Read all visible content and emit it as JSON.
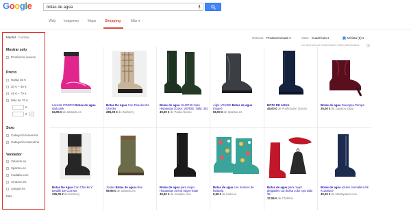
{
  "header": {
    "logo": [
      "G",
      "o",
      "o",
      "g",
      "l",
      "e"
    ],
    "logo_colors": [
      "#4285f4",
      "#ea4335",
      "#fbbc05",
      "#4285f4",
      "#34a853",
      "#ea4335"
    ],
    "search_value": "botas de agua"
  },
  "tabs": [
    "Web",
    "Imágenes",
    "Maps",
    "Shopping",
    "Más ▾"
  ],
  "active_tab": "Shopping",
  "sidebar": {
    "location": "Madrid",
    "location_change": "Cambiar",
    "show_only_head": "Mostrar solo",
    "show_only_items": [
      "Productos nuevos"
    ],
    "price_head": "Precio",
    "price_items": [
      "Hasta 30 €",
      "30 € – 45 €",
      "45 € – 70 €",
      "Más de 70 €"
    ],
    "price_currency": "€",
    "price_go": "›",
    "sex_head": "Sexo",
    "sex_items": [
      "Categoría femenina",
      "Categoría masculina"
    ],
    "seller_head": "Vendedor",
    "seller_items": [
      "Zalando.es",
      "Spartoo.es",
      "modalia.com",
      "Amazon.es",
      "camper.es"
    ],
    "more": "Más"
  },
  "controls": {
    "sort_label": "Ordenar:",
    "sort_value": "Predeterminada ▾",
    "view_label": "Vista:",
    "view_value": "Cuadrícula ▾",
    "mylist": "Mi lista (0) ▾",
    "note": "Los anuncios de comerciantes están patrocinados"
  },
  "products": [
    {
      "title_pre": "Lacoste POERIO ",
      "title_bold": "Botas de agua",
      "title_post": " dark pink",
      "price": "64,95 €",
      "seller": " de Zalando.es"
    },
    {
      "title_pre": "",
      "title_bold": "Botas De Agua",
      "title_post": " Con Paneles De Checks",
      "price": "285,00 €",
      "seller": " de Burberry"
    },
    {
      "title_pre": "",
      "title_bold": "Botas de agua",
      "title_post": " HI-40746 mate Hispanitas (Color: VERDE, Talla: 36)",
      "price": "49,90 €",
      "seller": " de Paula Alonso"
    },
    {
      "title_pre": "Aigle VENISE ",
      "title_bold": "Botas de agua",
      "title_post": " (mujer)",
      "price": "59,00 €",
      "seller": " de Spartoo.es"
    },
    {
      "title_pre": "",
      "title_bold": "BOTA DE AGUA",
      "title_post": "",
      "price": "45,00 €",
      "seller": " de Purificación García"
    },
    {
      "title_pre": "",
      "title_bold": "Botas de agua",
      "title_post": " Giuseppo Pampa",
      "price": "35,00 €",
      "seller": " de Zapatos Zapp"
    },
    {
      "title_pre": "",
      "title_bold": "Botas De Agua",
      "title_post": " Con Checks Y Detalle De Correas",
      "price": "235,00 €",
      "seller": " de Burberry"
    },
    {
      "title_pre": "Joules ",
      "title_bold": "Botas de agua",
      "title_post": " olive",
      "price": "59,95 €",
      "seller": " de Zalando.es"
    },
    {
      "title_pre": "",
      "title_bold": "Botas de agua",
      "title_post": " para mujer Hispanitas 40746 negro-mate",
      "price": "49,90 €",
      "seller": " de modalia.com"
    },
    {
      "title_pre": "",
      "title_bold": "Botas de agua",
      "title_post": " con motivos de fantasía",
      "price": "9,99 €",
      "seller": " de Kiabi.es"
    },
    {
      "title_pre": "",
      "title_bold": "Botas de agua",
      "title_post": " para mujer plegables con bolsa color rojo talla 35",
      "price": "37,55 €",
      "seller": " de Chollitos"
    },
    {
      "title_pre": "",
      "title_bold": "Botas de agua",
      "title_post": " azules cremallera bk #1209207",
      "price": "49,00 €",
      "seller": " de MisZapatos.com"
    }
  ]
}
